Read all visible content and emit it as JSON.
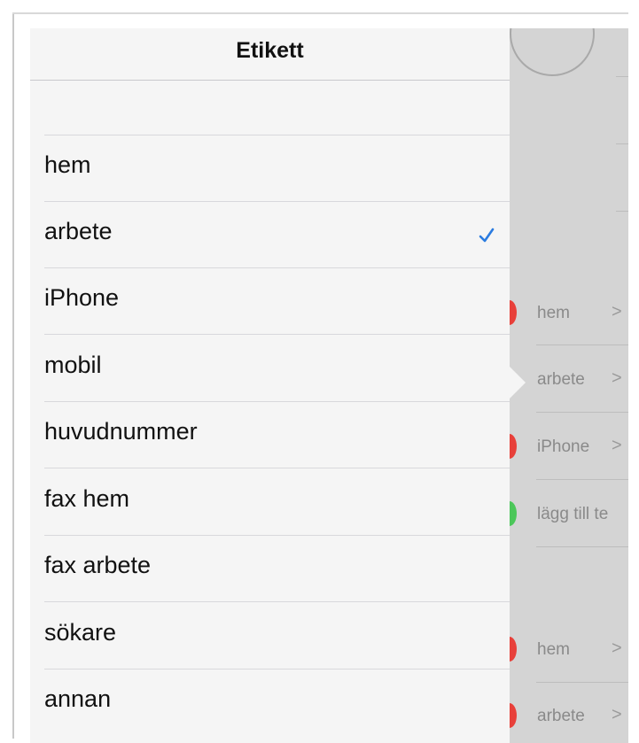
{
  "popover": {
    "title": "Etikett",
    "selected_index": 1,
    "options": [
      {
        "label": "hem"
      },
      {
        "label": "arbete"
      },
      {
        "label": "iPhone"
      },
      {
        "label": "mobil"
      },
      {
        "label": "huvudnummer"
      },
      {
        "label": "fax hem"
      },
      {
        "label": "fax arbete"
      },
      {
        "label": "sökare"
      },
      {
        "label": "annan"
      }
    ]
  },
  "background": {
    "rows": [
      {
        "label": "hem",
        "dot": "red"
      },
      {
        "label": "arbete",
        "dot": ""
      },
      {
        "label": "iPhone",
        "dot": "red"
      },
      {
        "label": "lägg till te",
        "dot": "green"
      },
      {
        "label": "hem",
        "dot": "red"
      },
      {
        "label": "arbete",
        "dot": "red"
      }
    ],
    "chevron": ">"
  },
  "colors": {
    "accent": "#2a7be0",
    "delete_red": "#e8403a",
    "add_green": "#4cc75a"
  },
  "icons": {
    "check": "checkmark-icon",
    "chevron": "chevron-right-icon"
  }
}
